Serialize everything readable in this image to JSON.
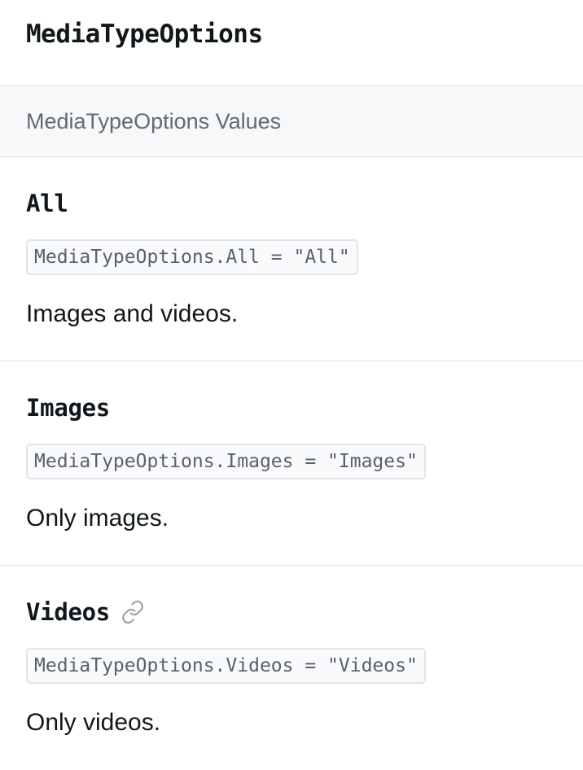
{
  "page": {
    "title": "MediaTypeOptions"
  },
  "section": {
    "header": "MediaTypeOptions Values"
  },
  "entries": [
    {
      "name": "All",
      "code": "MediaTypeOptions.All = \"All\"",
      "description": "Images and videos."
    },
    {
      "name": "Images",
      "code": "MediaTypeOptions.Images = \"Images\"",
      "description": "Only images."
    },
    {
      "name": "Videos",
      "code": "MediaTypeOptions.Videos = \"Videos\"",
      "description": "Only videos.",
      "icon": "link-icon"
    }
  ],
  "colors": {
    "icon": "#9aa0a6",
    "chip_border": "#e2e4e7",
    "header_bg": "#f7f8f9"
  }
}
